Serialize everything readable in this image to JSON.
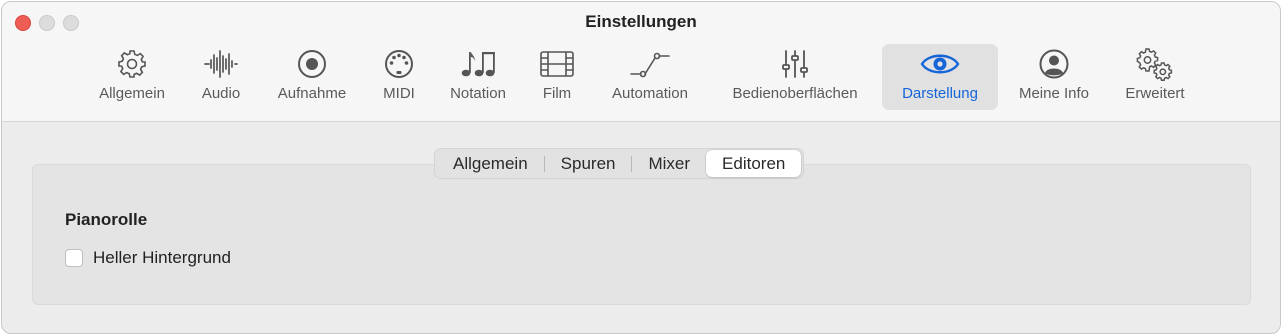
{
  "window": {
    "title": "Einstellungen"
  },
  "toolbar": {
    "items": [
      {
        "label": "Allgemein",
        "icon": "gear-icon"
      },
      {
        "label": "Audio",
        "icon": "waveform-icon"
      },
      {
        "label": "Aufnahme",
        "icon": "record-icon"
      },
      {
        "label": "MIDI",
        "icon": "midi-port-icon"
      },
      {
        "label": "Notation",
        "icon": "notes-icon"
      },
      {
        "label": "Film",
        "icon": "film-icon"
      },
      {
        "label": "Automation",
        "icon": "automation-icon"
      },
      {
        "label": "Bedienoberflächen",
        "icon": "sliders-icon"
      },
      {
        "label": "Darstellung",
        "icon": "eye-icon",
        "selected": true
      },
      {
        "label": "Meine Info",
        "icon": "person-icon"
      },
      {
        "label": "Erweitert",
        "icon": "gears-icon"
      }
    ],
    "accent_color": "#1565d8"
  },
  "tabs": {
    "items": [
      "Allgemein",
      "Spuren",
      "Mixer",
      "Editoren"
    ],
    "selected": "Editoren"
  },
  "section": {
    "title": "Pianorolle",
    "checkbox_label": "Heller Hintergrund",
    "checkbox_checked": false
  }
}
